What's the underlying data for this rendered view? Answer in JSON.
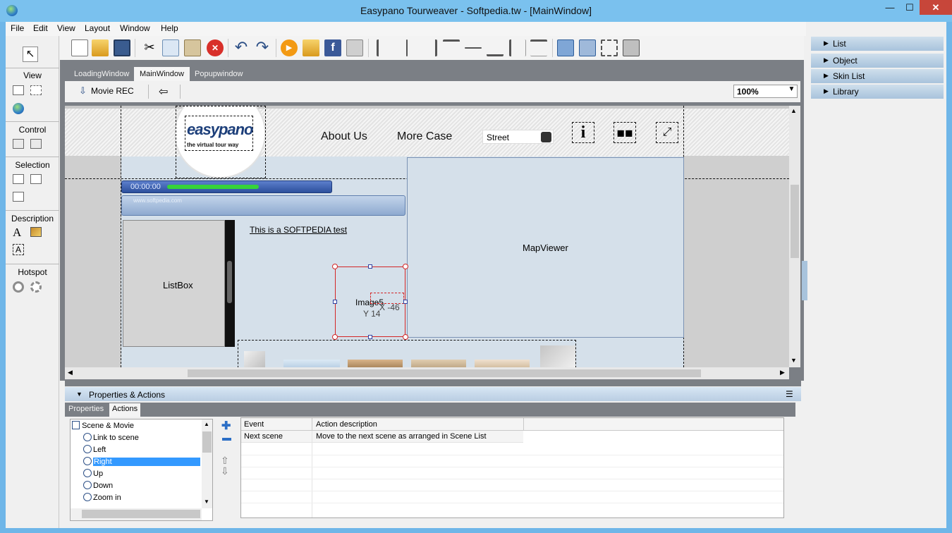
{
  "window": {
    "title": "Easypano Tourweaver - Softpedia.tw - [MainWindow]",
    "minimize": "—",
    "maximize": "☐",
    "close": "✕"
  },
  "menu": [
    "File",
    "Edit",
    "View",
    "Layout",
    "Window",
    "Help"
  ],
  "left_panel": {
    "sections": [
      {
        "title": "View"
      },
      {
        "title": "Control"
      },
      {
        "title": "Selection"
      },
      {
        "title": "Description"
      },
      {
        "title": "Hotspot"
      }
    ],
    "text_tool": "A",
    "textbox_tool": "A"
  },
  "tabs": [
    "LoadingWindow",
    "MainWindow",
    "Popupwindow"
  ],
  "subbar": {
    "movie_rec": "Movie REC",
    "zoom": "100%"
  },
  "canvas": {
    "logo_main": "easypano",
    "logo_tagline": "the virtual tour way",
    "nav_about": "About Us",
    "nav_more": "More Case",
    "street_select": "Street",
    "info_icon_text": "i",
    "timer": "00:00:00",
    "softpedia_watermark": "www.softpedia.com",
    "listbox_label": "ListBox",
    "link_text": "This is a SOFTPEDIA test",
    "mapviewer_label": "MapViewer",
    "image_label": "Image5",
    "coord_x": "X -46",
    "coord_y": "Y 14"
  },
  "properties": {
    "header": "Properties & Actions",
    "tabs": [
      "Properties",
      "Actions"
    ],
    "tree": {
      "root": "Scene & Movie",
      "items": [
        "Link to scene",
        "Left",
        "Right",
        "Up",
        "Down",
        "Zoom in"
      ],
      "selected": "Right"
    },
    "table": {
      "columns": [
        "Event",
        "Action description"
      ],
      "rows": [
        {
          "event": "Next scene",
          "description": "Move to the next scene as arranged in Scene List"
        }
      ]
    }
  },
  "right_panel": [
    "List",
    "Object",
    "Skin List",
    "Library"
  ],
  "colors": {
    "titlebar": "#7ac1ee",
    "selection": "#3399ff",
    "canvas_bg": "#d5e0ea",
    "editor_bg": "#7b7f85"
  }
}
